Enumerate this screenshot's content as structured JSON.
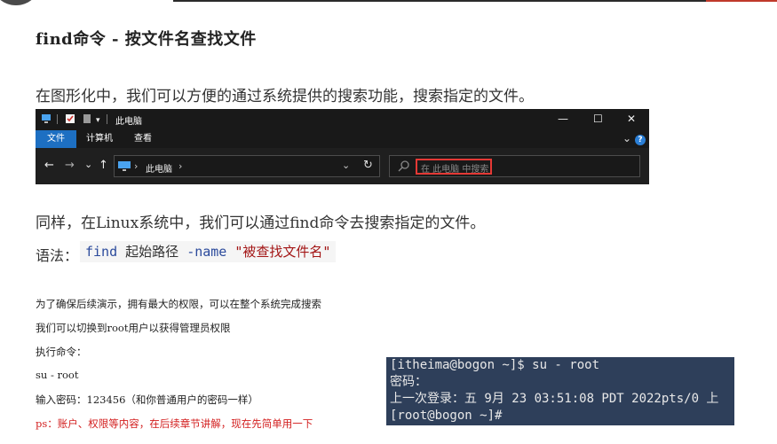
{
  "heading": "find命令 - 按文件名查找文件",
  "para1": "在图形化中，我们可以方便的通过系统提供的搜索功能，搜索指定的文件。",
  "explorer": {
    "title": "此电脑",
    "window_controls": {
      "minimize": "—",
      "maximize": "☐",
      "close": "✕"
    },
    "ribbon_tabs": [
      "文件",
      "计算机",
      "查看"
    ],
    "ribbon_expand": "⌄",
    "help": "?",
    "nav": {
      "back": "←",
      "forward": "→",
      "recent": "⌄",
      "up": "↑"
    },
    "address": "此电脑",
    "address_chevron": "›",
    "address_dropdown": "⌄",
    "refresh": "↻",
    "search_placeholder": "在 此电脑 中搜索"
  },
  "para2": "同样，在Linux系统中，我们可以通过find命令去搜索指定的文件。",
  "syntax": {
    "label": "语法：",
    "cmd": "find",
    "arg1": " 起始路径 ",
    "opt": "-name",
    "str": " \"被查找文件名\""
  },
  "notes": [
    "为了确保后续演示，拥有最大的权限，可以在整个系统完成搜索",
    "我们可以切换到root用户以获得管理员权限",
    "执行命令：",
    "su - root",
    "输入密码：123456（和你普通用户的密码一样）",
    "ps：账户、权限等内容，在后续章节讲解，现在先简单用一下"
  ],
  "terminal": [
    "[itheima@bogon ~]$ su - root",
    "密码：",
    "上一次登录：五 9月 23 03:51:08 PDT 2022pts/0 上",
    "[root@bogon ~]#"
  ],
  "colors": {
    "explorer_bg": "#191919",
    "ribbon_active": "#1d6fc2",
    "search_highlight": "#e53935",
    "terminal_bg": "#2e3f5a",
    "note_red": "#d32020"
  }
}
